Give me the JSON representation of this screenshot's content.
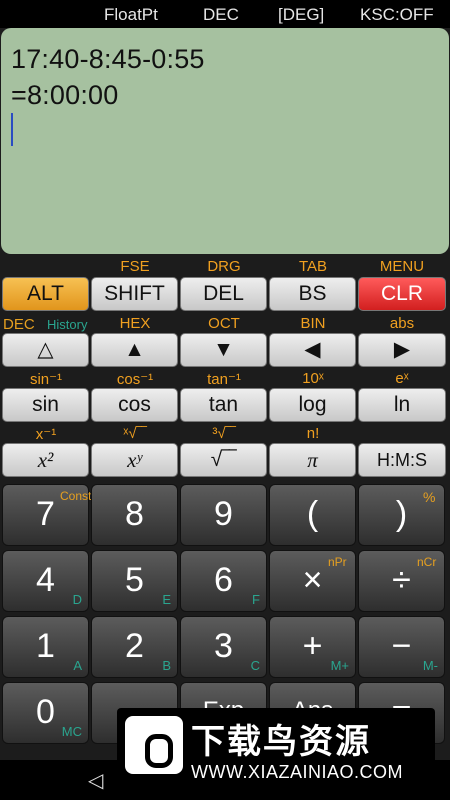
{
  "status_bar": {
    "float": "FloatPt",
    "base": "DEC",
    "angle": "[DEG]",
    "ksc": "KSC:OFF"
  },
  "display": {
    "expression": "17:40-8:45-0:55",
    "result": "=8:00:00"
  },
  "row1_labels": [
    "FSE",
    "DRG",
    "TAB",
    "MENU"
  ],
  "row1_keys": [
    "ALT",
    "SHIFT",
    "DEL",
    "BS",
    "CLR"
  ],
  "row2_labels": [
    "DEC",
    "History",
    "HEX",
    "OCT",
    "BIN",
    "abs"
  ],
  "row2_keys": [
    "△",
    "▲",
    "▼",
    "◀",
    "▶"
  ],
  "row3_labels": [
    "sin⁻¹",
    "cos⁻¹",
    "tan⁻¹",
    "10ˣ",
    "eˣ"
  ],
  "row3_keys": [
    "sin",
    "cos",
    "tan",
    "log",
    "ln"
  ],
  "row4_labels": [
    "x⁻¹",
    "ˣ√‾‾",
    "³√‾‾",
    "n!"
  ],
  "row4_keys": [
    "x²",
    "xʸ",
    "√‾‾",
    "π",
    "H:M:S"
  ],
  "numpad": [
    {
      "main": "7",
      "sup": "Const",
      "sub": ""
    },
    {
      "main": "8",
      "sup": "",
      "sub": ""
    },
    {
      "main": "9",
      "sup": "",
      "sub": ""
    },
    {
      "main": "(",
      "sup": "",
      "sub": ""
    },
    {
      "main": ")",
      "sup": "%",
      "sub": ""
    },
    {
      "main": "4",
      "sup": "",
      "sub": "D"
    },
    {
      "main": "5",
      "sup": "",
      "sub": "E"
    },
    {
      "main": "6",
      "sup": "",
      "sub": "F"
    },
    {
      "main": "×",
      "sup": "nPr",
      "sub": ""
    },
    {
      "main": "÷",
      "sup": "nCr",
      "sub": ""
    },
    {
      "main": "1",
      "sup": "",
      "sub": "A"
    },
    {
      "main": "2",
      "sup": "",
      "sub": "B"
    },
    {
      "main": "3",
      "sup": "",
      "sub": "C"
    },
    {
      "main": "+",
      "sup": "",
      "sub": "M+"
    },
    {
      "main": "−",
      "sup": "",
      "sub": "M-"
    },
    {
      "main": "0",
      "sup": "",
      "sub": "MC"
    },
    {
      "main": ".",
      "sup": "",
      "sub": ""
    },
    {
      "main": "Exp",
      "sup": "",
      "sub": ""
    },
    {
      "main": "Ans",
      "sup": "",
      "sub": ""
    },
    {
      "main": "=",
      "sup": "",
      "sub": ""
    }
  ],
  "nav": {
    "back_icon": "◁"
  },
  "banner": {
    "title": "下载鸟资源",
    "url": "WWW.XIAZAINIAO.COM"
  },
  "colors": {
    "accent": "#e1951c",
    "clear": "#d21f1f",
    "display_bg": "#a6c1a0",
    "sub_label": "#2aa58f"
  }
}
